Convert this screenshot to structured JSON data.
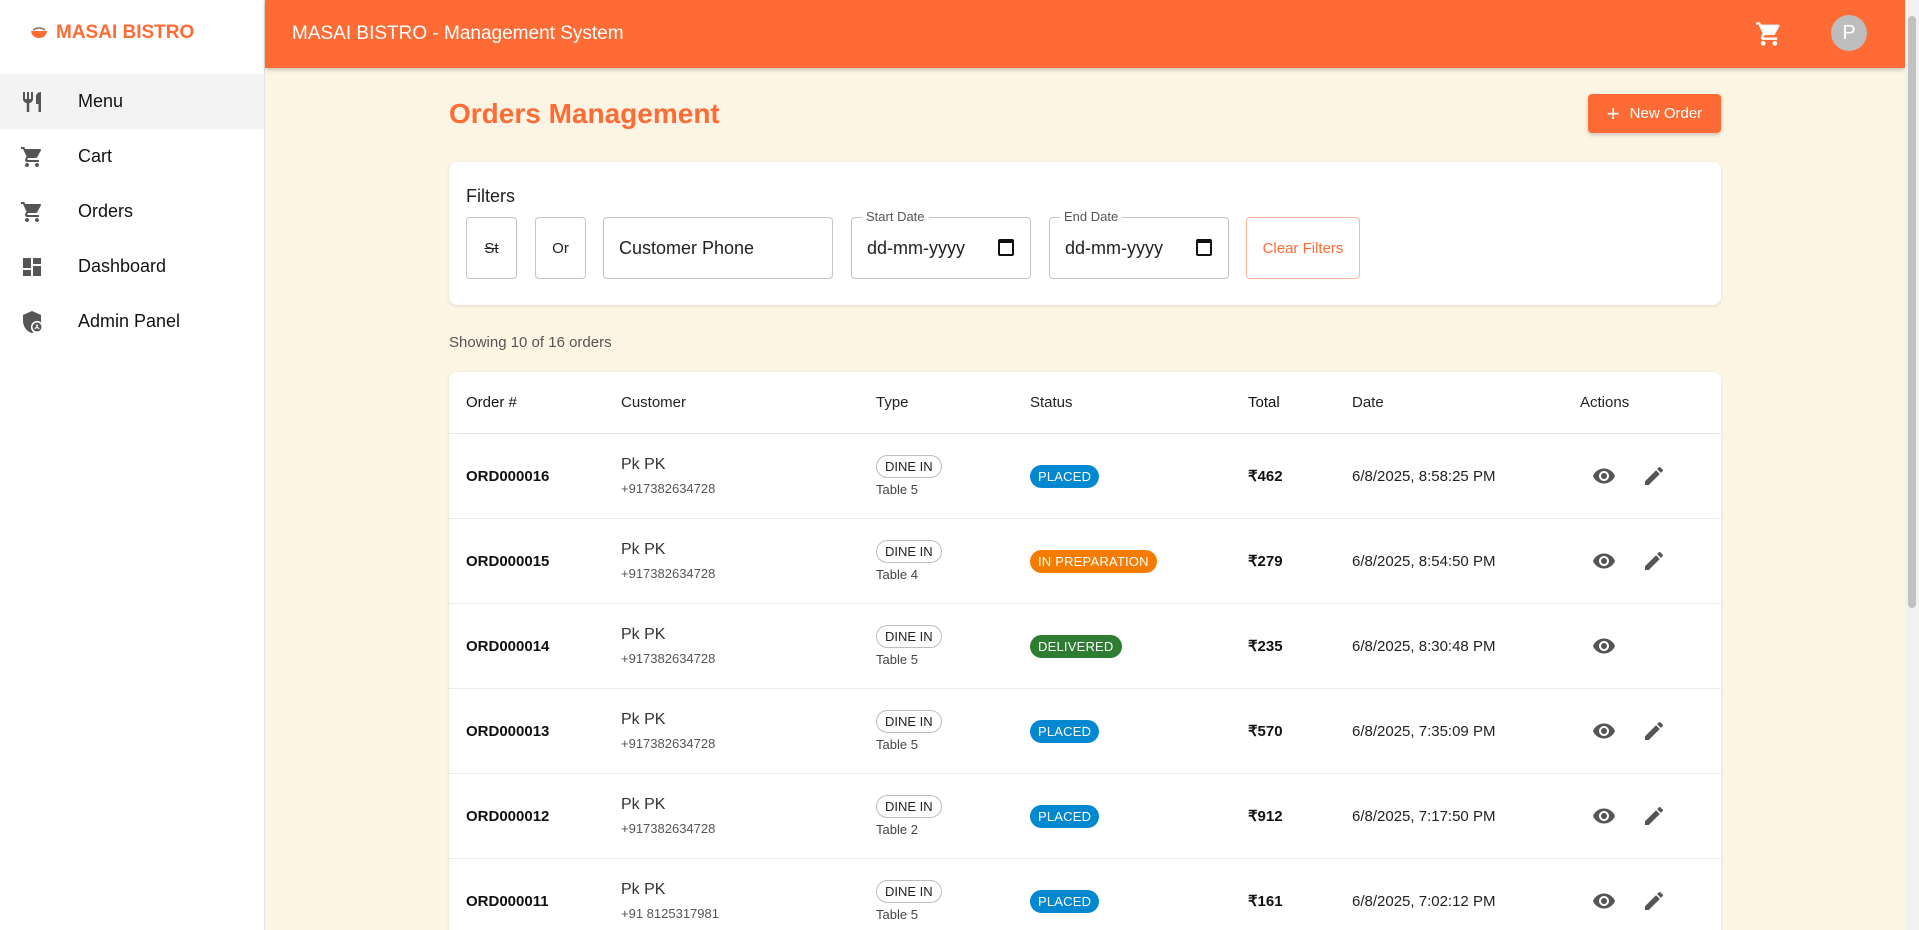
{
  "brand": {
    "name": "MASAI BISTRO"
  },
  "sidebar": {
    "items": [
      {
        "label": "Menu",
        "icon": "fork-knife-icon"
      },
      {
        "label": "Cart",
        "icon": "cart-icon"
      },
      {
        "label": "Orders",
        "icon": "cart-icon"
      },
      {
        "label": "Dashboard",
        "icon": "dashboard-icon"
      },
      {
        "label": "Admin Panel",
        "icon": "admin-shield-icon"
      }
    ]
  },
  "topbar": {
    "title": "MASAI BISTRO - Management System",
    "avatar_letter": "P"
  },
  "page": {
    "title": "Orders Management",
    "new_order_label": "New Order"
  },
  "filters": {
    "title": "Filters",
    "status_value": "St",
    "type_value": "Or",
    "phone_value": "Customer Phone",
    "start_label": "Start Date",
    "start_value": "dd-mm-yyyy",
    "end_label": "End Date",
    "end_value": "dd-mm-yyyy",
    "clear_label": "Clear Filters"
  },
  "summary": {
    "showing": "Showing 10 of 16 orders"
  },
  "table": {
    "headers": {
      "order": "Order #",
      "customer": "Customer",
      "type": "Type",
      "status": "Status",
      "total": "Total",
      "date": "Date",
      "actions": "Actions"
    },
    "rows": [
      {
        "order": "ORD000016",
        "name": "Pk PK",
        "phone": "+917382634728",
        "type": "DINE IN",
        "table": "Table 5",
        "status": "PLACED",
        "total": "₹462",
        "date": "6/8/2025, 8:58:25 PM"
      },
      {
        "order": "ORD000015",
        "name": "Pk PK",
        "phone": "+917382634728",
        "type": "DINE IN",
        "table": "Table 4",
        "status": "IN PREPARATION",
        "total": "₹279",
        "date": "6/8/2025, 8:54:50 PM"
      },
      {
        "order": "ORD000014",
        "name": "Pk PK",
        "phone": "+917382634728",
        "type": "DINE IN",
        "table": "Table 5",
        "status": "DELIVERED",
        "total": "₹235",
        "date": "6/8/2025, 8:30:48 PM"
      },
      {
        "order": "ORD000013",
        "name": "Pk PK",
        "phone": "+917382634728",
        "type": "DINE IN",
        "table": "Table 5",
        "status": "PLACED",
        "total": "₹570",
        "date": "6/8/2025, 7:35:09 PM"
      },
      {
        "order": "ORD000012",
        "name": "Pk PK",
        "phone": "+917382634728",
        "type": "DINE IN",
        "table": "Table 2",
        "status": "PLACED",
        "total": "₹912",
        "date": "6/8/2025, 7:17:50 PM"
      },
      {
        "order": "ORD000011",
        "name": "Pk PK",
        "phone": "+91 8125317981",
        "type": "DINE IN",
        "table": "Table 5",
        "status": "PLACED",
        "total": "₹161",
        "date": "6/8/2025, 7:02:12 PM"
      }
    ]
  },
  "colors": {
    "accent": "#ff6b35",
    "background": "#fdf5e4",
    "status_placed": "#0288d1",
    "status_in_preparation": "#f57c00",
    "status_delivered": "#2e7d32"
  }
}
